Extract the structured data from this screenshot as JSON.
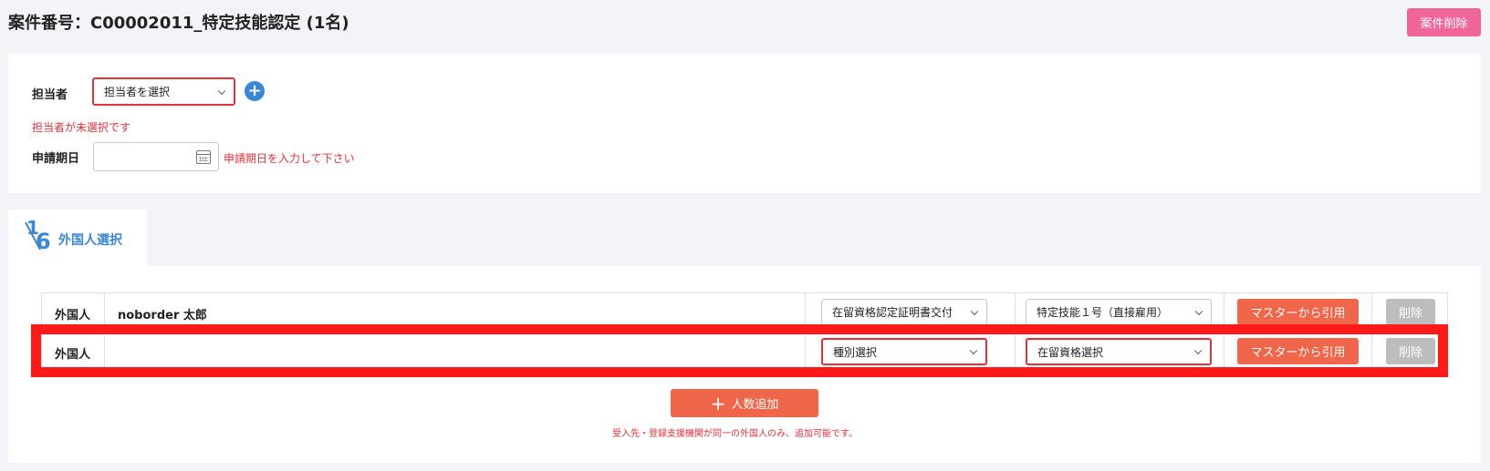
{
  "header": {
    "title": "案件番号：C00002011_特定技能認定 (1名)",
    "delete_case_label": "案件削除"
  },
  "assignee": {
    "label": "担当者",
    "select_value": "担当者を選択",
    "add_icon": "plus-circle-icon",
    "error": "担当者が未選択です"
  },
  "application_date": {
    "label": "申請期日",
    "value": "",
    "calendar_icon": "calendar-icon",
    "error": "申請期日を入力して下さい"
  },
  "tab": {
    "step_current": "1",
    "step_total": "6",
    "label": "外国人選択"
  },
  "rows": [
    {
      "label": "外国人",
      "name": "noborder 太郎",
      "type_select": "在留資格認定証明書交付",
      "status_select": "特定技能１号（直接雇用）",
      "master_btn": "マスターから引用",
      "delete_btn": "削除"
    },
    {
      "label": "外国人",
      "name": "",
      "type_select": "種別選択",
      "status_select": "在留資格選択",
      "master_btn": "マスターから引用",
      "delete_btn": "削除"
    }
  ],
  "add_people": {
    "label": "人数追加",
    "note": "受入先・登録支援機関が同一の外国人のみ、追加可能です。"
  },
  "colors": {
    "accent_blue": "#3a87d8",
    "button_orange": "#f0664a",
    "error_red": "#e8303a",
    "delete_pink": "#f0669a",
    "highlight_red": "#ff1a1a"
  }
}
